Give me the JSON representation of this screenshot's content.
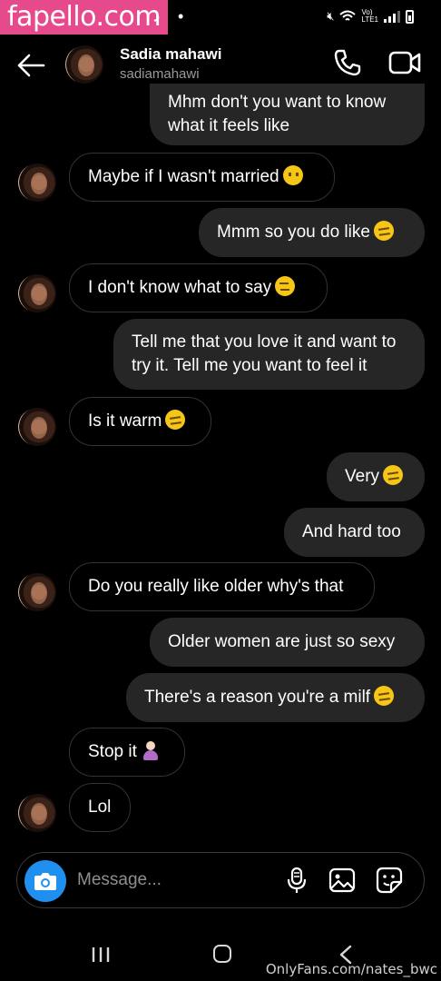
{
  "status_bar": {
    "watermark": "fapello.com",
    "network": "Vo)\nLTE1"
  },
  "header": {
    "name": "Sadia mahawi",
    "username": "sadiamahawi"
  },
  "messages": [
    {
      "from": "me",
      "text": "Mhm don't you want to know what it feels like"
    },
    {
      "from": "them",
      "text": "Maybe if I wasn't married",
      "emoji": "face-without-mouth"
    },
    {
      "from": "me",
      "text": "Mmm so you do like",
      "emoji": "smirk"
    },
    {
      "from": "them",
      "text": "I don't know what to say",
      "emoji": "expressionless"
    },
    {
      "from": "me",
      "text": "Tell me that you love it and want to try it. Tell me you want to feel it"
    },
    {
      "from": "them",
      "text": "Is it warm",
      "emoji": "smirk"
    },
    {
      "from": "me",
      "text": "Very",
      "emoji": "smirk"
    },
    {
      "from": "me",
      "text": "And hard too"
    },
    {
      "from": "them",
      "text": "Do you really like older why's that"
    },
    {
      "from": "me",
      "text": "Older women are just so sexy"
    },
    {
      "from": "me",
      "text": "There's a reason you're a milf",
      "emoji": "smirk"
    },
    {
      "from": "them",
      "text": "Stop it",
      "emoji": "woman-raising-hand"
    },
    {
      "from": "them",
      "text": "Lol"
    }
  ],
  "composer": {
    "placeholder": "Message...",
    "value": ""
  },
  "watermark_bottom": "OnlyFans.com/nates_bwc",
  "colors": {
    "background": "#000000",
    "bubble": "#262626",
    "camera_button": "#1f8ff0",
    "watermark": "#e64a8c"
  }
}
